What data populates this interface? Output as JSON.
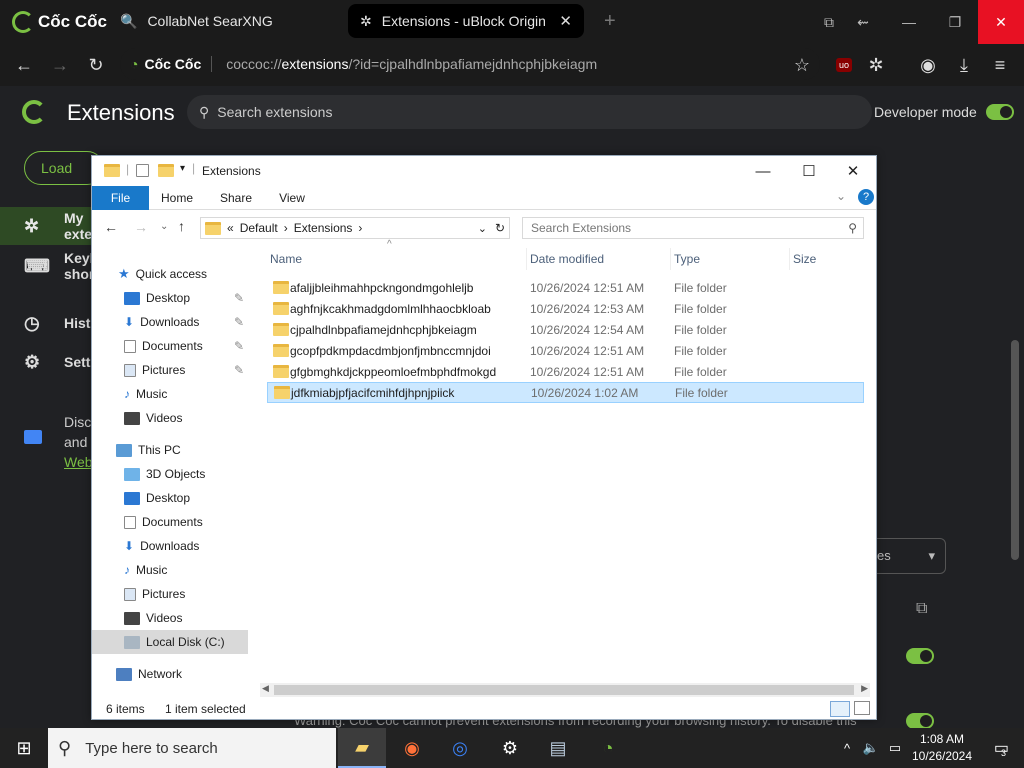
{
  "browser": {
    "brand": "Cốc Cốc",
    "tabs": [
      {
        "label": "CollabNet SearXNG"
      },
      {
        "label": "Extensions - uBlock Origin"
      }
    ],
    "address": {
      "site": "Cốc Cốc",
      "prefix": "coccoc://",
      "bold": "extensions",
      "suffix": "/?id=cjpalhdlnbpafiamejdnhcphjbkeiagm"
    }
  },
  "extensions_page": {
    "title": "Extensions",
    "search_placeholder": "Search extensions",
    "developer_mode": "Developer mode",
    "load_unpacked": "Load unpacked",
    "sidebar": [
      {
        "label": "My extensions",
        "icon": "puzzle-icon"
      },
      {
        "label": "Keyboard shortcuts",
        "icon": "keyboard-icon"
      },
      {
        "label": "History",
        "icon": "history-icon"
      },
      {
        "label": "Settings",
        "icon": "gear-icon"
      }
    ],
    "promo": {
      "line1": "Discover more extensions and",
      "line2": "and themes on the",
      "link": "Web Store"
    },
    "dropdown": "es",
    "warning": "Warning: Cốc Cốc cannot prevent extensions from recording your browsing history. To disable this"
  },
  "explorer": {
    "title": "Extensions",
    "ribbon": [
      "File",
      "Home",
      "Share",
      "View"
    ],
    "breadcrumb": [
      "Default",
      "Extensions"
    ],
    "search_placeholder": "Search Extensions",
    "columns": [
      "Name",
      "Date modified",
      "Type",
      "Size"
    ],
    "nav": {
      "quick_access": "Quick access",
      "quick_items": [
        "Desktop",
        "Downloads",
        "Documents",
        "Pictures",
        "Music",
        "Videos"
      ],
      "this_pc": "This PC",
      "pc_items": [
        "3D Objects",
        "Desktop",
        "Documents",
        "Downloads",
        "Music",
        "Pictures",
        "Videos",
        "Local Disk (C:)"
      ],
      "network": "Network"
    },
    "files": [
      {
        "name": "afaljjbleihmahhpckngondmgohleljb",
        "date": "10/26/2024 12:51 AM",
        "type": "File folder"
      },
      {
        "name": "aghfnjkcakhmadgdomlmlhhaocbkloab",
        "date": "10/26/2024 12:53 AM",
        "type": "File folder"
      },
      {
        "name": "cjpalhdlnbpafiamejdnhcphjbkeiagm",
        "date": "10/26/2024 12:54 AM",
        "type": "File folder"
      },
      {
        "name": "gcopfpdkmpdacdmbjonfjmbnccmnjdoi",
        "date": "10/26/2024 12:51 AM",
        "type": "File folder"
      },
      {
        "name": "gfgbmghkdjckppeomloefmbphdfmokgd",
        "date": "10/26/2024 12:51 AM",
        "type": "File folder"
      },
      {
        "name": "jdfkmiabjpfjacifcmihfdjhpnjpiick",
        "date": "10/26/2024 1:02 AM",
        "type": "File folder"
      }
    ],
    "status": {
      "count": "6 items",
      "selected": "1 item selected"
    }
  },
  "taskbar": {
    "search": "Type here to search",
    "time": "1:08 AM",
    "date": "10/26/2024",
    "notifications": "3"
  }
}
